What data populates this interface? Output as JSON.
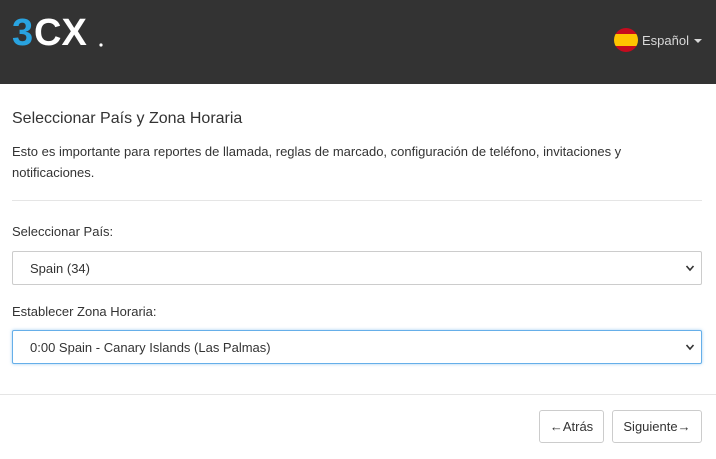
{
  "header": {
    "logo_text": "3CX",
    "language_label": "Español",
    "flag_icon": "spain-flag-icon"
  },
  "page": {
    "title": "Seleccionar País y Zona Horaria",
    "description": "Esto es importante para reportes de llamada, reglas de marcado, configuración de teléfono, invitaciones y notificaciones."
  },
  "country": {
    "label": "Seleccionar País:",
    "selected": "Spain (34)"
  },
  "timezone": {
    "label": "Establecer Zona Horaria:",
    "selected": "0:00 Spain - Canary Islands (Las Palmas)"
  },
  "footer": {
    "back_label": "←Atrás",
    "next_label": "Siguiente→"
  },
  "colors": {
    "header_bg": "#333333",
    "logo_blue": "#29a3e0",
    "focus_border": "#66afe9"
  }
}
